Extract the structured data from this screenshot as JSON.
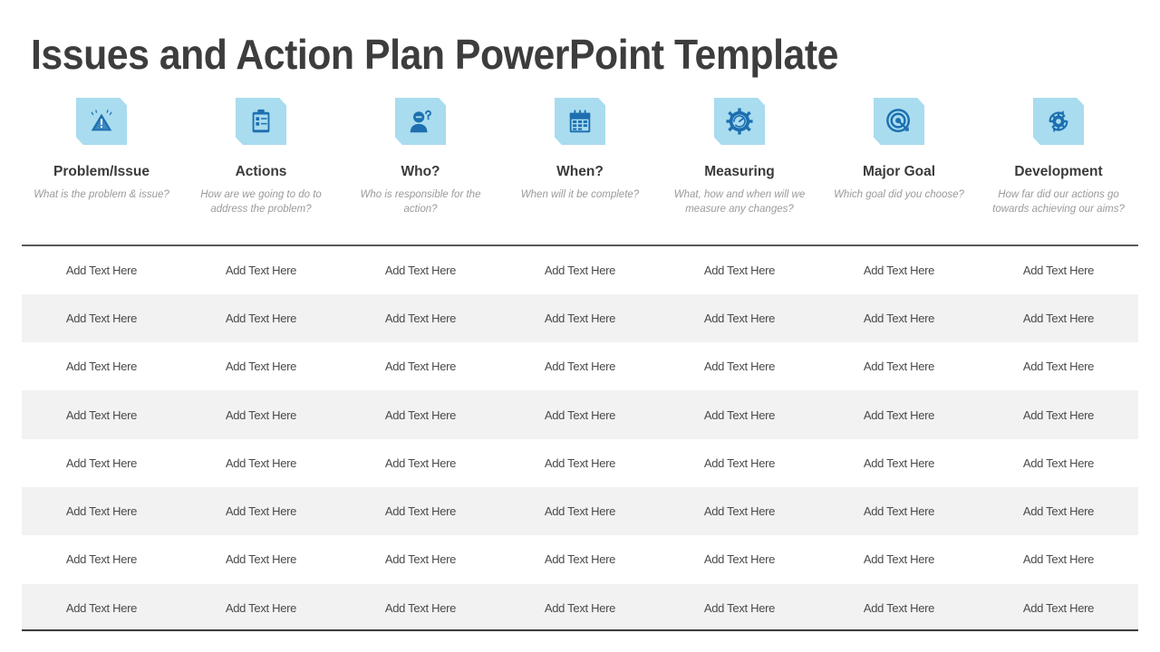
{
  "slide": {
    "title": "Issues and Action Plan PowerPoint Template",
    "accent_tile_color": "#a9dcef",
    "accent_icon_color": "#1d6fb0",
    "title_color": "#3d3d3d",
    "subtitle_color": "#9a9a9a",
    "row_alt_color": "#f2f2f2",
    "divider_color": "#595959"
  },
  "columns": [
    {
      "icon": "warning-triangle-icon",
      "title": "Problem/Issue",
      "subtitle": "What is the problem & issue?"
    },
    {
      "icon": "clipboard-checklist-icon",
      "title": "Actions",
      "subtitle": "How are we going to do to address the problem?"
    },
    {
      "icon": "person-question-icon",
      "title": "Who?",
      "subtitle": "Who is responsible for the action?"
    },
    {
      "icon": "calendar-icon",
      "title": "When?",
      "subtitle": "When will it be complete?"
    },
    {
      "icon": "gear-gauge-icon",
      "title": "Measuring",
      "subtitle": "What, how and when will we measure any changes?"
    },
    {
      "icon": "target-arrow-icon",
      "title": "Major Goal",
      "subtitle": "Which goal did you choose?"
    },
    {
      "icon": "gear-refresh-icon",
      "title": "Development",
      "subtitle": "How far did our actions go towards achieving our aims?"
    }
  ],
  "table": {
    "placeholder_cell": "Add Text Here",
    "rows": [
      [
        "Add Text Here",
        "Add Text Here",
        "Add Text Here",
        "Add Text Here",
        "Add Text Here",
        "Add Text Here",
        "Add Text Here"
      ],
      [
        "Add Text Here",
        "Add Text Here",
        "Add Text Here",
        "Add Text Here",
        "Add Text Here",
        "Add Text Here",
        "Add Text Here"
      ],
      [
        "Add Text Here",
        "Add Text Here",
        "Add Text Here",
        "Add Text Here",
        "Add Text Here",
        "Add Text Here",
        "Add Text Here"
      ],
      [
        "Add Text Here",
        "Add Text Here",
        "Add Text Here",
        "Add Text Here",
        "Add Text Here",
        "Add Text Here",
        "Add Text Here"
      ],
      [
        "Add Text Here",
        "Add Text Here",
        "Add Text Here",
        "Add Text Here",
        "Add Text Here",
        "Add Text Here",
        "Add Text Here"
      ],
      [
        "Add Text Here",
        "Add Text Here",
        "Add Text Here",
        "Add Text Here",
        "Add Text Here",
        "Add Text Here",
        "Add Text Here"
      ],
      [
        "Add Text Here",
        "Add Text Here",
        "Add Text Here",
        "Add Text Here",
        "Add Text Here",
        "Add Text Here",
        "Add Text Here"
      ],
      [
        "Add Text Here",
        "Add Text Here",
        "Add Text Here",
        "Add Text Here",
        "Add Text Here",
        "Add Text Here",
        "Add Text Here"
      ]
    ]
  }
}
